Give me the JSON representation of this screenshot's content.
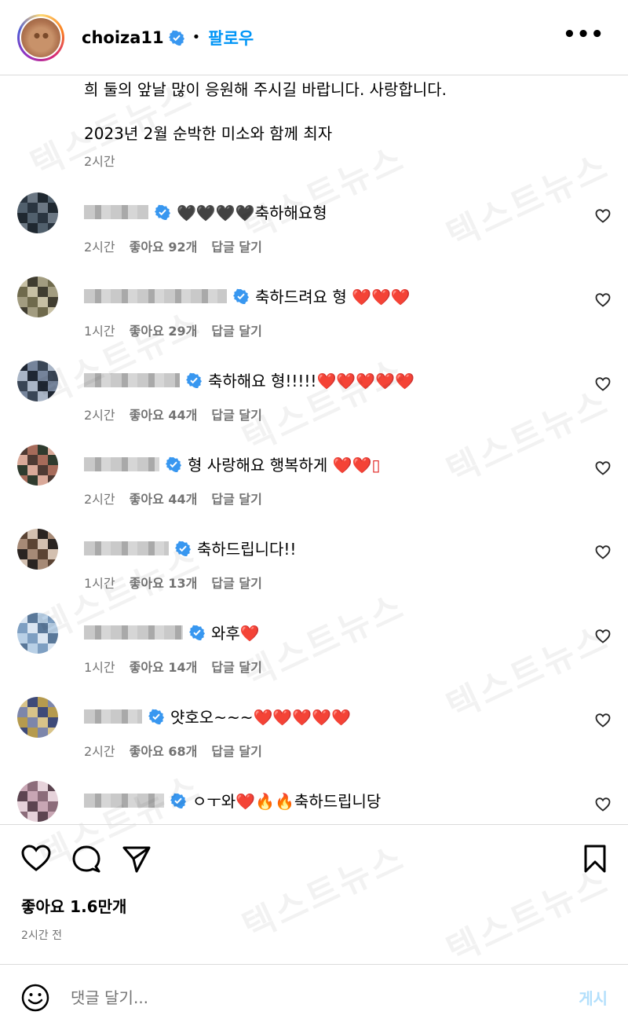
{
  "header": {
    "username": "choiza11",
    "follow_label": "팔로우",
    "separator": "•",
    "more_icon": "more-horizontal-icon"
  },
  "caption": {
    "line1": "희 둘의 앞날 많이 응원해 주시길 바랍니다. 사랑합니다.",
    "line2": "2023년 2월 순박한 미소와 함께 최자",
    "time": "2시간"
  },
  "colors": {
    "accent": "#0095f6",
    "verified": "#3897f0",
    "heart_emoji": "#e0201e",
    "muted": "#737373",
    "post_disabled": "#b2dffc"
  },
  "comments": [
    {
      "text_prefix": "",
      "emoji_before": "🖤🖤🖤🖤",
      "text": "축하해요형",
      "emoji_after": "",
      "time": "2시간",
      "likes": "좋아요 92개",
      "reply": "답글 달기"
    },
    {
      "text_prefix": "",
      "emoji_before": "",
      "text": "축하드려요 형 ",
      "emoji_after": "❤️❤️❤️",
      "time": "1시간",
      "likes": "좋아요 29개",
      "reply": "답글 달기"
    },
    {
      "text_prefix": "",
      "emoji_before": "",
      "text": "축하해요 형!!!!!",
      "emoji_after": "❤️❤️❤️❤️❤️",
      "time": "2시간",
      "likes": "좋아요 44개",
      "reply": "답글 달기"
    },
    {
      "text_prefix": "",
      "emoji_before": "",
      "text": "형 사랑해요 행복하게 ",
      "emoji_after": "❤️❤️▯",
      "time": "2시간",
      "likes": "좋아요 44개",
      "reply": "답글 달기"
    },
    {
      "text_prefix": "",
      "emoji_before": "",
      "text": "축하드립니다!!",
      "emoji_after": "",
      "time": "1시간",
      "likes": "좋아요 13개",
      "reply": "답글 달기"
    },
    {
      "text_prefix": "",
      "emoji_before": "",
      "text": "와후",
      "emoji_after": "❤️",
      "time": "1시간",
      "likes": "좋아요 14개",
      "reply": "답글 달기"
    },
    {
      "text_prefix": "",
      "emoji_before": "",
      "text": "얏호오~~~",
      "emoji_after": "❤️❤️❤️❤️❤️",
      "time": "2시간",
      "likes": "좋아요 68개",
      "reply": "답글 달기"
    },
    {
      "text_prefix": "ㅇㅜ와",
      "emoji_before": "",
      "text": "",
      "emoji_after": "❤️🔥🔥",
      "text_suffix": "축하드립니당",
      "time": "",
      "likes": "",
      "reply": ""
    }
  ],
  "footer": {
    "likes": "좋아요 1.6만개",
    "time": "2시간 전",
    "comment_placeholder": "댓글 달기...",
    "post_label": "게시"
  },
  "watermark": "텍스트뉴스"
}
